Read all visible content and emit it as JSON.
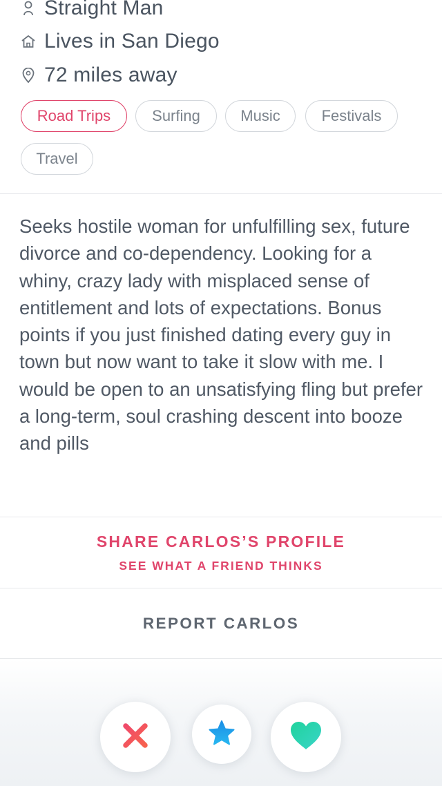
{
  "profile": {
    "orientation": "Straight Man",
    "residence": "Lives in San Diego",
    "distance": "72 miles away"
  },
  "passions": [
    {
      "label": "Road Trips",
      "active": true
    },
    {
      "label": "Surfing",
      "active": false
    },
    {
      "label": "Music",
      "active": false
    },
    {
      "label": "Festivals",
      "active": false
    },
    {
      "label": "Travel",
      "active": false
    }
  ],
  "bio": "Seeks hostile woman for unfulfilling sex, future divorce and co-dependency. Looking for a whiny, crazy lady with misplaced sense of entitlement and lots of expectations. Bonus points if you just finished dating every guy in town but now want to take it slow with me. I would be open to an unsatisfying fling but prefer a long-term, soul crashing descent into booze and pills",
  "share": {
    "title": "SHARE CARLOS’S PROFILE",
    "subtitle": "SEE WHAT A FRIEND THINKS"
  },
  "report": {
    "label": "REPORT CARLOS"
  },
  "actions": [
    {
      "name": "nope",
      "icon": "x-icon"
    },
    {
      "name": "super-like",
      "icon": "star-icon"
    },
    {
      "name": "like",
      "icon": "heart-icon"
    }
  ],
  "colors": {
    "accent": "#e0456b",
    "nope": "#f2496e",
    "super_like": "#1a9be8",
    "like": "#2fd3a6"
  }
}
